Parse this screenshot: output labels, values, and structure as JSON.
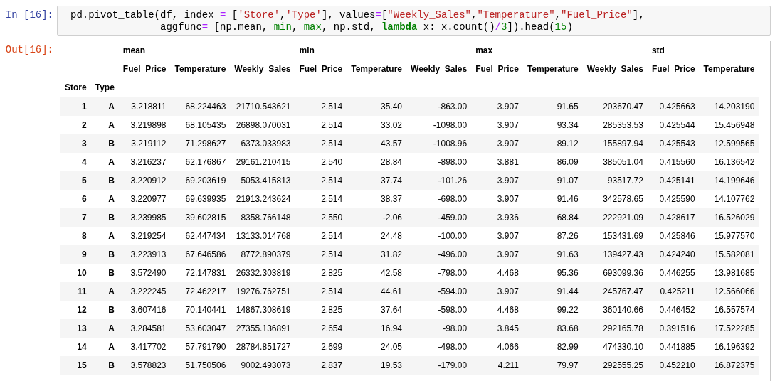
{
  "input_cell": {
    "prompt": "In [16]:",
    "lines": [
      [
        {
          "kind": "plain",
          "text": "pd.pivot_table(df, index "
        },
        {
          "kind": "op",
          "text": "="
        },
        {
          "kind": "plain",
          "text": " ["
        },
        {
          "kind": "string",
          "text": "'Store'"
        },
        {
          "kind": "plain",
          "text": ","
        },
        {
          "kind": "string",
          "text": "'Type'"
        },
        {
          "kind": "plain",
          "text": "], values"
        },
        {
          "kind": "op",
          "text": "="
        },
        {
          "kind": "plain",
          "text": "["
        },
        {
          "kind": "string",
          "text": "\"Weekly_Sales\""
        },
        {
          "kind": "plain",
          "text": ","
        },
        {
          "kind": "string",
          "text": "\"Temperature\""
        },
        {
          "kind": "plain",
          "text": ","
        },
        {
          "kind": "string",
          "text": "\"Fuel_Price\""
        },
        {
          "kind": "plain",
          "text": "],"
        }
      ],
      [
        {
          "kind": "plain",
          "text": "               aggfunc"
        },
        {
          "kind": "op",
          "text": "="
        },
        {
          "kind": "plain",
          "text": " [np.mean, "
        },
        {
          "kind": "builtin",
          "text": "min"
        },
        {
          "kind": "plain",
          "text": ", "
        },
        {
          "kind": "builtin",
          "text": "max"
        },
        {
          "kind": "plain",
          "text": ", np.std, "
        },
        {
          "kind": "keyword",
          "text": "lambda"
        },
        {
          "kind": "plain",
          "text": " x: x.count()"
        },
        {
          "kind": "op",
          "text": "/"
        },
        {
          "kind": "number",
          "text": "3"
        },
        {
          "kind": "plain",
          "text": "]).head("
        },
        {
          "kind": "number",
          "text": "15"
        },
        {
          "kind": "plain",
          "text": ")"
        }
      ]
    ]
  },
  "output_cell": {
    "prompt": "Out[16]:",
    "table": {
      "column_groups": [
        {
          "label": "mean",
          "columns": [
            "Fuel_Price",
            "Temperature",
            "Weekly_Sales"
          ]
        },
        {
          "label": "min",
          "columns": [
            "Fuel_Price",
            "Temperature",
            "Weekly_Sales"
          ]
        },
        {
          "label": "max",
          "columns": [
            "Fuel_Price",
            "Temperature",
            "Weekly_Sales"
          ]
        },
        {
          "label": "std",
          "columns": [
            "Fuel_Price",
            "Temperature"
          ]
        }
      ],
      "index_names": [
        "Store",
        "Type"
      ],
      "rows": [
        {
          "index": [
            "1",
            "A"
          ],
          "values": [
            "3.218811",
            "68.224463",
            "21710.543621",
            "2.514",
            "35.40",
            "-863.00",
            "3.907",
            "91.65",
            "203670.47",
            "0.425663",
            "14.203190"
          ]
        },
        {
          "index": [
            "2",
            "A"
          ],
          "values": [
            "3.219898",
            "68.105435",
            "26898.070031",
            "2.514",
            "33.02",
            "-1098.00",
            "3.907",
            "93.34",
            "285353.53",
            "0.425544",
            "15.456948"
          ]
        },
        {
          "index": [
            "3",
            "B"
          ],
          "values": [
            "3.219112",
            "71.298627",
            "6373.033983",
            "2.514",
            "43.57",
            "-1008.96",
            "3.907",
            "89.12",
            "155897.94",
            "0.425543",
            "12.599565"
          ]
        },
        {
          "index": [
            "4",
            "A"
          ],
          "values": [
            "3.216237",
            "62.176867",
            "29161.210415",
            "2.540",
            "28.84",
            "-898.00",
            "3.881",
            "86.09",
            "385051.04",
            "0.415560",
            "16.136542"
          ]
        },
        {
          "index": [
            "5",
            "B"
          ],
          "values": [
            "3.220912",
            "69.203619",
            "5053.415813",
            "2.514",
            "37.74",
            "-101.26",
            "3.907",
            "91.07",
            "93517.72",
            "0.425141",
            "14.199646"
          ]
        },
        {
          "index": [
            "6",
            "A"
          ],
          "values": [
            "3.220977",
            "69.639935",
            "21913.243624",
            "2.514",
            "38.37",
            "-698.00",
            "3.907",
            "91.46",
            "342578.65",
            "0.425590",
            "14.107762"
          ]
        },
        {
          "index": [
            "7",
            "B"
          ],
          "values": [
            "3.239985",
            "39.602815",
            "8358.766148",
            "2.550",
            "-2.06",
            "-459.00",
            "3.936",
            "68.84",
            "222921.09",
            "0.428617",
            "16.526029"
          ]
        },
        {
          "index": [
            "8",
            "A"
          ],
          "values": [
            "3.219254",
            "62.447434",
            "13133.014768",
            "2.514",
            "24.48",
            "-100.00",
            "3.907",
            "87.26",
            "153431.69",
            "0.425846",
            "15.977570"
          ]
        },
        {
          "index": [
            "9",
            "B"
          ],
          "values": [
            "3.223913",
            "67.646586",
            "8772.890379",
            "2.514",
            "31.82",
            "-496.00",
            "3.907",
            "91.63",
            "139427.43",
            "0.424240",
            "15.582081"
          ]
        },
        {
          "index": [
            "10",
            "B"
          ],
          "values": [
            "3.572490",
            "72.147831",
            "26332.303819",
            "2.825",
            "42.58",
            "-798.00",
            "4.468",
            "95.36",
            "693099.36",
            "0.446255",
            "13.981685"
          ]
        },
        {
          "index": [
            "11",
            "A"
          ],
          "values": [
            "3.222245",
            "72.462217",
            "19276.762751",
            "2.514",
            "44.61",
            "-594.00",
            "3.907",
            "91.44",
            "245767.47",
            "0.425211",
            "12.566066"
          ]
        },
        {
          "index": [
            "12",
            "B"
          ],
          "values": [
            "3.607416",
            "70.140441",
            "14867.308619",
            "2.825",
            "37.64",
            "-598.00",
            "4.468",
            "99.22",
            "360140.66",
            "0.446452",
            "16.557574"
          ]
        },
        {
          "index": [
            "13",
            "A"
          ],
          "values": [
            "3.284581",
            "53.603047",
            "27355.136891",
            "2.654",
            "16.94",
            "-98.00",
            "3.845",
            "83.68",
            "292165.78",
            "0.391516",
            "17.522285"
          ]
        },
        {
          "index": [
            "14",
            "A"
          ],
          "values": [
            "3.417702",
            "57.791790",
            "28784.851727",
            "2.699",
            "24.05",
            "-498.00",
            "4.066",
            "82.99",
            "474330.10",
            "0.441885",
            "16.196392"
          ]
        },
        {
          "index": [
            "15",
            "B"
          ],
          "values": [
            "3.578823",
            "51.750506",
            "9002.493073",
            "2.837",
            "19.53",
            "-179.00",
            "4.211",
            "79.97",
            "292555.25",
            "0.452210",
            "16.872375"
          ]
        }
      ]
    }
  }
}
